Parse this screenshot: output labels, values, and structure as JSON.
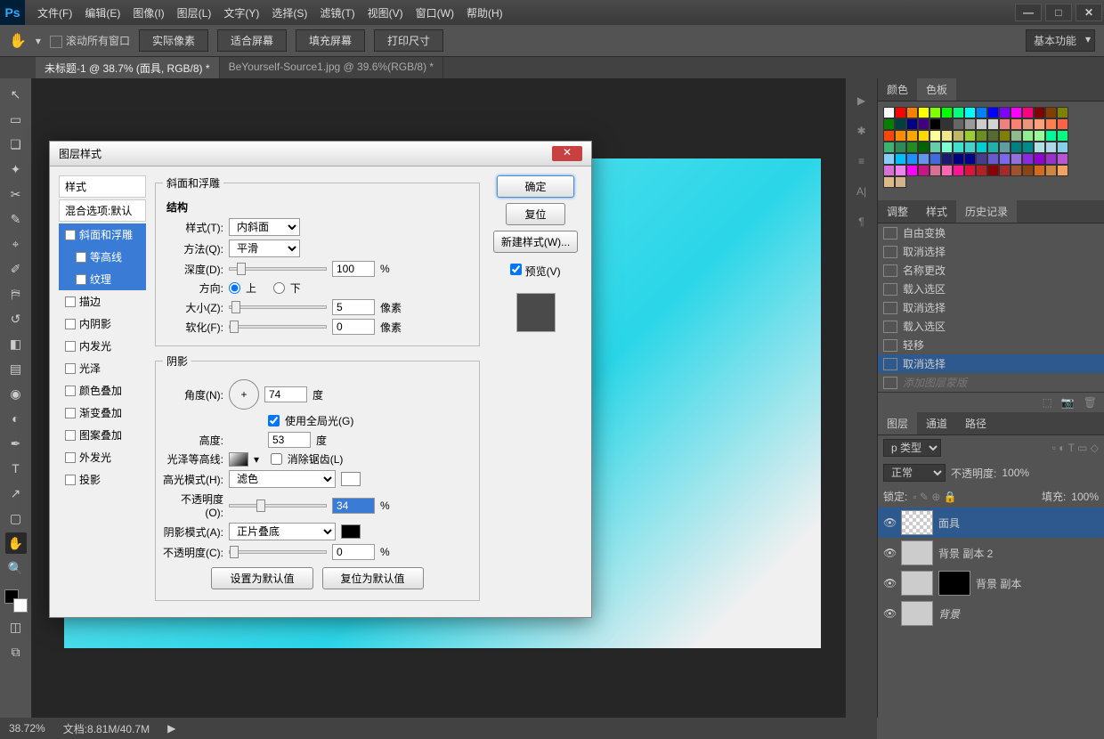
{
  "menu": [
    "文件(F)",
    "编辑(E)",
    "图像(I)",
    "图层(L)",
    "文字(Y)",
    "选择(S)",
    "滤镜(T)",
    "视图(V)",
    "窗口(W)",
    "帮助(H)"
  ],
  "options": {
    "scroll": "滚动所有窗口",
    "b1": "实际像素",
    "b2": "适合屏幕",
    "b3": "填充屏幕",
    "b4": "打印尺寸",
    "preset": "基本功能"
  },
  "tabs": [
    "未标题-1 @ 38.7% (面具, RGB/8) *",
    "BeYourself-Source1.jpg @ 39.6%(RGB/8) *"
  ],
  "rightPanels": {
    "colorTab": "颜色",
    "swatchTab": "色板",
    "adjTab": "调整",
    "styleTab": "样式",
    "histTab": "历史记录",
    "layerTab": "图层",
    "chanTab": "通道",
    "pathTab": "路径"
  },
  "history": [
    "自由变换",
    "取消选择",
    "名称更改",
    "载入选区",
    "取消选择",
    "载入选区",
    "轻移",
    "取消选择",
    "添加图层蒙版"
  ],
  "layers": {
    "kind": "p 类型",
    "blend": "正常",
    "opLbl": "不透明度:",
    "op": "100%",
    "lockLbl": "锁定:",
    "fillLbl": "填充:",
    "fill": "100%",
    "items": [
      {
        "n": "面具",
        "sel": true
      },
      {
        "n": "背景 副本 2"
      },
      {
        "n": "背景 副本",
        "mask": true
      },
      {
        "n": "背景",
        "it": true
      }
    ]
  },
  "dlg": {
    "title": "图层样式",
    "stylesLbl": "样式",
    "blendOpt": "混合选项:默认",
    "left": [
      "斜面和浮雕",
      "等高线",
      "纹理",
      "描边",
      "内阴影",
      "内发光",
      "光泽",
      "颜色叠加",
      "渐变叠加",
      "图案叠加",
      "外发光",
      "投影"
    ],
    "bevel": "斜面和浮雕",
    "struct": "结构",
    "styleLbl": "样式(T):",
    "styleVal": "内斜面",
    "methodLbl": "方法(Q):",
    "methodVal": "平滑",
    "depthLbl": "深度(D):",
    "depth": "100",
    "pct": "%",
    "dirLbl": "方向:",
    "up": "上",
    "down": "下",
    "sizeLbl": "大小(Z):",
    "size": "5",
    "px": "像素",
    "softLbl": "软化(F):",
    "soft": "0",
    "shade": "阴影",
    "angleLbl": "角度(N):",
    "angle": "74",
    "deg": "度",
    "globalLbl": "使用全局光(G)",
    "altLbl": "高度:",
    "alt": "53",
    "glossLbl": "光泽等高线:",
    "aaLbl": "消除锯齿(L)",
    "hlModeLbl": "高光模式(H):",
    "hlMode": "滤色",
    "opLbl": "不透明度(O):",
    "hlOp": "34",
    "shModeLbl": "阴影模式(A):",
    "shMode": "正片叠底",
    "opLbl2": "不透明度(C):",
    "shOp": "0",
    "setDef": "设置为默认值",
    "resetDef": "复位为默认值",
    "ok": "确定",
    "cancel": "复位",
    "newStyle": "新建样式(W)...",
    "preview": "预览(V)"
  },
  "status": {
    "zoom": "38.72%",
    "doc": "文档:8.81M/40.7M"
  },
  "swatchColors": [
    "#ffffff",
    "#ff0000",
    "#ff8000",
    "#ffff00",
    "#80ff00",
    "#00ff00",
    "#00ff80",
    "#00ffff",
    "#0080ff",
    "#0000ff",
    "#8000ff",
    "#ff00ff",
    "#ff0080",
    "#800000",
    "#804000",
    "#808000",
    "#008000",
    "#004040",
    "#000080",
    "#400080",
    "#000000",
    "#333333",
    "#666666",
    "#999999",
    "#cccccc",
    "#d3d3d3",
    "#f08080",
    "#fa8072",
    "#e9967a",
    "#ffa07a",
    "#ff7f50",
    "#ff6347",
    "#ff4500",
    "#ff8c00",
    "#ffa500",
    "#ffd700",
    "#ffff99",
    "#f0e68c",
    "#bdb76b",
    "#9acd32",
    "#6b8e23",
    "#556b2f",
    "#808000",
    "#8fbc8f",
    "#90ee90",
    "#98fb98",
    "#00fa9a",
    "#00ff7f",
    "#3cb371",
    "#2e8b57",
    "#228b22",
    "#006400",
    "#66cdaa",
    "#7fffd4",
    "#40e0d0",
    "#48d1cc",
    "#00ced1",
    "#20b2aa",
    "#5f9ea0",
    "#008080",
    "#008b8b",
    "#b0e0e6",
    "#add8e6",
    "#87ceeb",
    "#87cefa",
    "#00bfff",
    "#1e90ff",
    "#6495ed",
    "#4169e1",
    "#191970",
    "#000080",
    "#00008b",
    "#483d8b",
    "#6a5acd",
    "#7b68ee",
    "#9370db",
    "#8a2be2",
    "#9400d3",
    "#9932cc",
    "#ba55d3",
    "#da70d6",
    "#ee82ee",
    "#ff00ff",
    "#c71585",
    "#d87093",
    "#ff69b4",
    "#ff1493",
    "#dc143c",
    "#b22222",
    "#8b0000",
    "#a52a2a",
    "#a0522d",
    "#8b4513",
    "#d2691e",
    "#cd853f",
    "#f4a460",
    "#deb887",
    "#d2b48c"
  ]
}
